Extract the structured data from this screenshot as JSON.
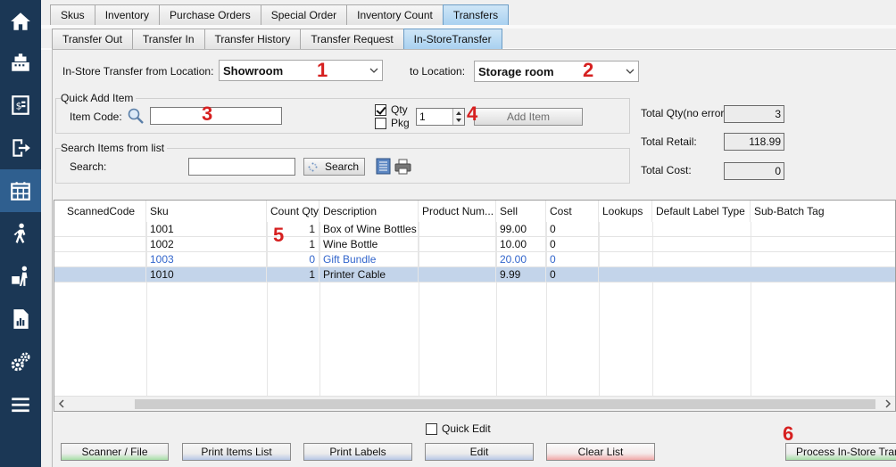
{
  "sidebar": {
    "items": [
      {
        "icon": "home-icon"
      },
      {
        "icon": "cash-register-icon"
      },
      {
        "icon": "receipt-dollar-icon"
      },
      {
        "icon": "logout-icon"
      },
      {
        "icon": "calendar-grid-icon",
        "active": true
      },
      {
        "icon": "walking-person-icon"
      },
      {
        "icon": "delivery-person-icon"
      },
      {
        "icon": "report-icon"
      },
      {
        "icon": "gears-icon"
      },
      {
        "icon": "menu-icon"
      }
    ]
  },
  "main_tabs": [
    "Skus",
    "Inventory",
    "Purchase Orders",
    "Special Order",
    "Inventory Count",
    "Transfers"
  ],
  "sub_tabs": [
    "Transfer Out",
    "Transfer In",
    "Transfer History",
    "Transfer Request",
    "In-StoreTransfer"
  ],
  "form": {
    "from_label": "In-Store Transfer from Location:",
    "from_value": "Showroom",
    "to_label": "to Location:",
    "to_value": "Storage room"
  },
  "quick_add": {
    "title": "Quick Add Item",
    "item_code_label": "Item Code:",
    "item_code_value": "",
    "qty_label": "Qty",
    "qty_checked": true,
    "pkg_label": "Pkg",
    "pkg_checked": false,
    "qty_value": "1",
    "add_item_label": "Add Item"
  },
  "search_section": {
    "title": "Search Items from list",
    "search_label": "Search:",
    "search_value": "",
    "search_button": "Search"
  },
  "totals": {
    "qty_label": "Total Qty(no error):",
    "qty_value": "3",
    "retail_label": "Total Retail:",
    "retail_value": "118.99",
    "cost_label": "Total Cost:",
    "cost_value": "0"
  },
  "annotations": [
    "1",
    "2",
    "3",
    "4",
    "5",
    "6"
  ],
  "table": {
    "columns": [
      "ScannedCode",
      "Sku",
      "Count Qty",
      "Description",
      "Product Num...",
      "Sell",
      "Cost",
      "Lookups",
      "Default Label Type",
      "Sub-Batch Tag"
    ],
    "rows": [
      {
        "scanned": "",
        "sku": "1001",
        "qty": "1",
        "desc": "Box of Wine Bottles",
        "product_num": "",
        "sell": "99.00",
        "cost": "0",
        "style": "normal"
      },
      {
        "scanned": "",
        "sku": "1002",
        "qty": "1",
        "desc": "Wine Bottle",
        "product_num": "",
        "sell": "10.00",
        "cost": "0",
        "style": "normal"
      },
      {
        "scanned": "",
        "sku": "1003",
        "qty": "0",
        "desc": "Gift Bundle",
        "product_num": "",
        "sell": "20.00",
        "cost": "0",
        "style": "blue"
      },
      {
        "scanned": "",
        "sku": "1010",
        "qty": "1",
        "desc": "Printer Cable",
        "product_num": "",
        "sell": "9.99",
        "cost": "0",
        "style": "selected"
      }
    ]
  },
  "bottom": {
    "quick_edit_label": "Quick Edit",
    "quick_edit_checked": false,
    "buttons": [
      "Scanner / File",
      "Print Items List",
      "Print Labels",
      "Edit",
      "Clear List",
      "Process In-Store Transf"
    ]
  },
  "colors": {
    "sidebar_bg": "#1b3755",
    "sidebar_active": "#2f5f8f",
    "annotation": "#d62020",
    "selected_row": "#c3d4ea",
    "blue_row_text": "#3366cc"
  }
}
